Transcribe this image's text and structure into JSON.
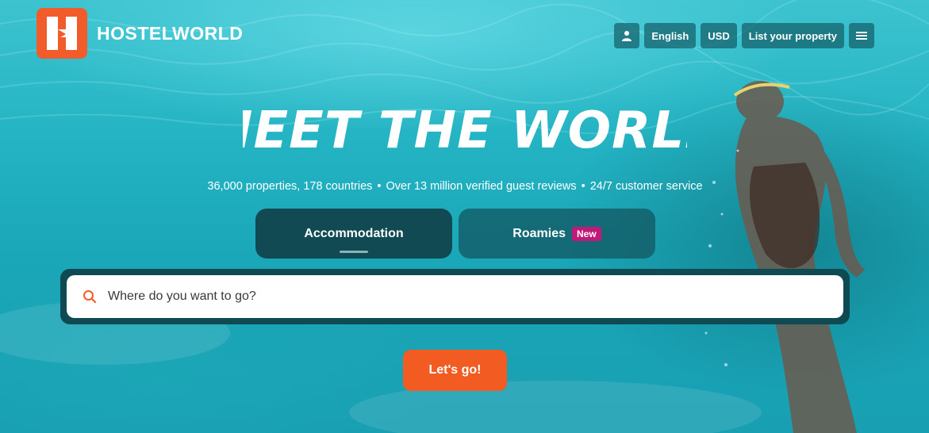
{
  "brand": {
    "name": "HOSTELWORLD",
    "accent_color": "#f25c2a"
  },
  "topnav": {
    "account_icon": "user-icon",
    "language": "English",
    "currency": "USD",
    "list_property": "List your property",
    "menu_icon": "hamburger-menu-icon"
  },
  "hero": {
    "headline": "MEET THE WORLD",
    "stats": [
      "36,000 properties, 178 countries",
      "Over 13 million verified guest reviews",
      "24/7 customer service"
    ],
    "separator": "•"
  },
  "tabs": [
    {
      "label": "Accommodation",
      "active": true
    },
    {
      "label": "Roamies",
      "badge": "New",
      "active": false
    }
  ],
  "search": {
    "placeholder": "Where do you want to go?",
    "value": "",
    "icon": "search-icon"
  },
  "cta": {
    "label": "Let's go!"
  }
}
